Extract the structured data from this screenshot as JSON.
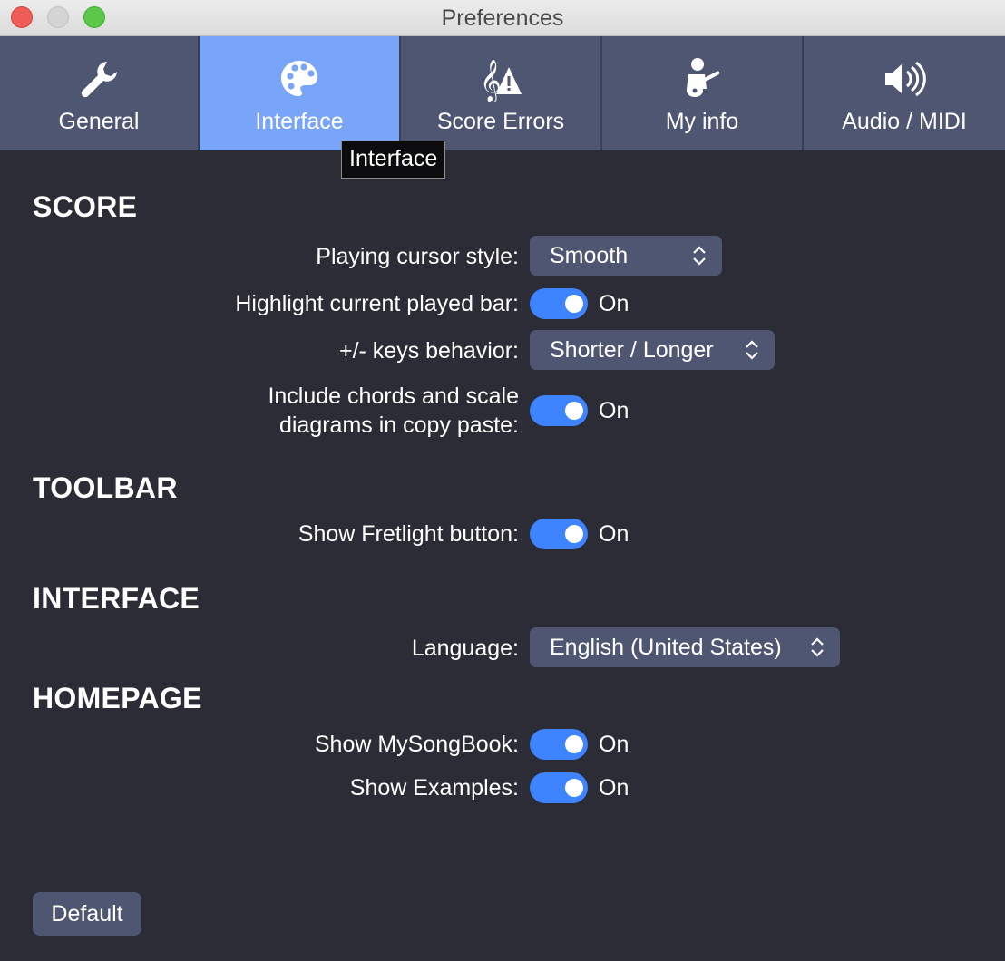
{
  "window": {
    "title": "Preferences"
  },
  "tabs": [
    {
      "label": "General",
      "icon": "wrench-icon",
      "active": false
    },
    {
      "label": "Interface",
      "icon": "palette-icon",
      "active": true
    },
    {
      "label": "Score Errors",
      "icon": "score-warning-icon",
      "active": false
    },
    {
      "label": "My info",
      "icon": "guitar-player-icon",
      "active": false
    },
    {
      "label": "Audio / MIDI",
      "icon": "speaker-icon",
      "active": false
    }
  ],
  "tooltip": {
    "text": "Interface"
  },
  "sections": {
    "score": {
      "heading": "SCORE",
      "playing_cursor": {
        "label": "Playing cursor style:",
        "value": "Smooth"
      },
      "highlight_bar": {
        "label": "Highlight current played bar:",
        "state": "On"
      },
      "keys_behavior": {
        "label": "+/- keys behavior:",
        "value": "Shorter / Longer"
      },
      "include_chords": {
        "label_line1": "Include chords and scale",
        "label_line2": "diagrams in copy paste:",
        "state": "On"
      }
    },
    "toolbar": {
      "heading": "TOOLBAR",
      "fretlight": {
        "label": "Show Fretlight button:",
        "state": "On"
      }
    },
    "interface": {
      "heading": "INTERFACE",
      "language": {
        "label": "Language:",
        "value": "English (United States)"
      }
    },
    "homepage": {
      "heading": "HOMEPAGE",
      "mysongbook": {
        "label": "Show MySongBook:",
        "state": "On"
      },
      "examples": {
        "label": "Show Examples:",
        "state": "On"
      }
    }
  },
  "footer": {
    "default_label": "Default"
  },
  "colors": {
    "background": "#2b2c35",
    "tab_bg": "#4f5671",
    "tab_active": "#79a5f8",
    "toggle_on": "#3e83ff"
  }
}
